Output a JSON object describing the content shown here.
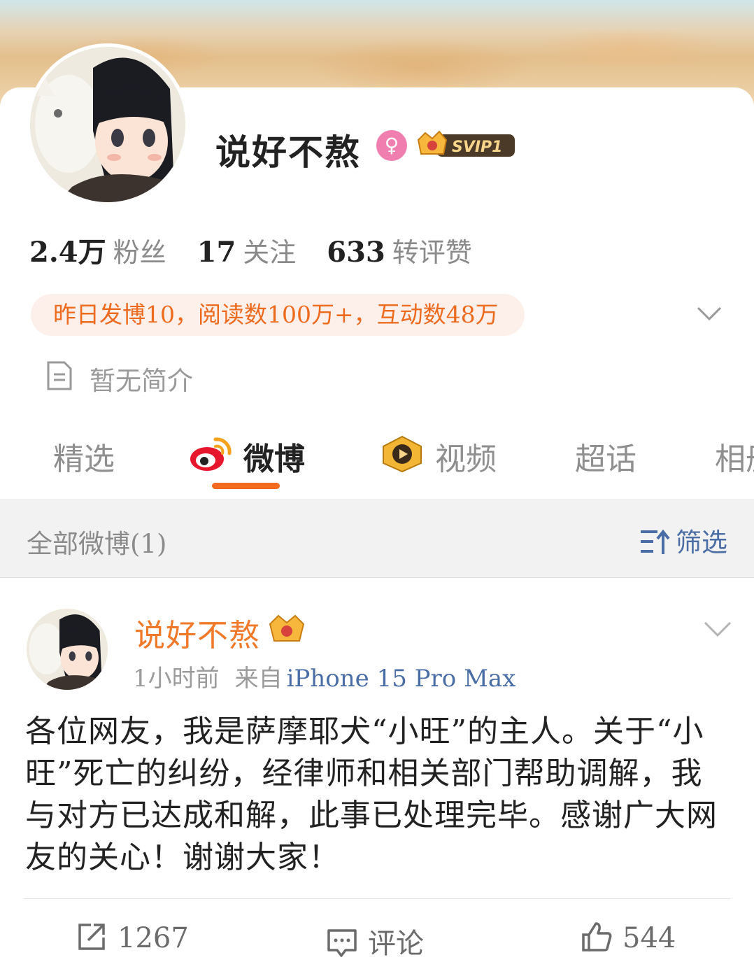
{
  "profile": {
    "name": "说好不熬",
    "gender_icon": "female-icon",
    "vip_badge": "SVIP1",
    "stats": [
      {
        "value": "2.4万",
        "label": "粉丝"
      },
      {
        "value": "17",
        "label": "关注"
      },
      {
        "value": "633",
        "label": "转评赞"
      }
    ],
    "highlight": "昨日发博10，阅读数100万+，互动数48万",
    "bio": "暂无简介"
  },
  "tabs": [
    {
      "label": "精选"
    },
    {
      "label": "微博"
    },
    {
      "label": "视频"
    },
    {
      "label": "超话"
    },
    {
      "label": "相册"
    }
  ],
  "active_tab": "微博",
  "filter_bar": {
    "title": "全部微博(1)",
    "filter_label": "筛选"
  },
  "post": {
    "author": "说好不熬",
    "time": "1小时前",
    "from_label": "来自",
    "device": "iPhone 15 Pro Max",
    "text": "各位网友，我是萨摩耶犬“小旺”的主人。关于“小旺”死亡的纠纷，经律师和相关部门帮助调解，我与对方已达成和解，此事已处理完毕。感谢广大网友的关心！谢谢大家！",
    "actions": {
      "repost": "1267",
      "comment": "评论",
      "like": "544"
    }
  },
  "colors": {
    "accent": "#f46a1e",
    "name_orange": "#f07a2a",
    "link_blue": "#4a6da5",
    "highlight_bg": "#fdf0ea"
  }
}
